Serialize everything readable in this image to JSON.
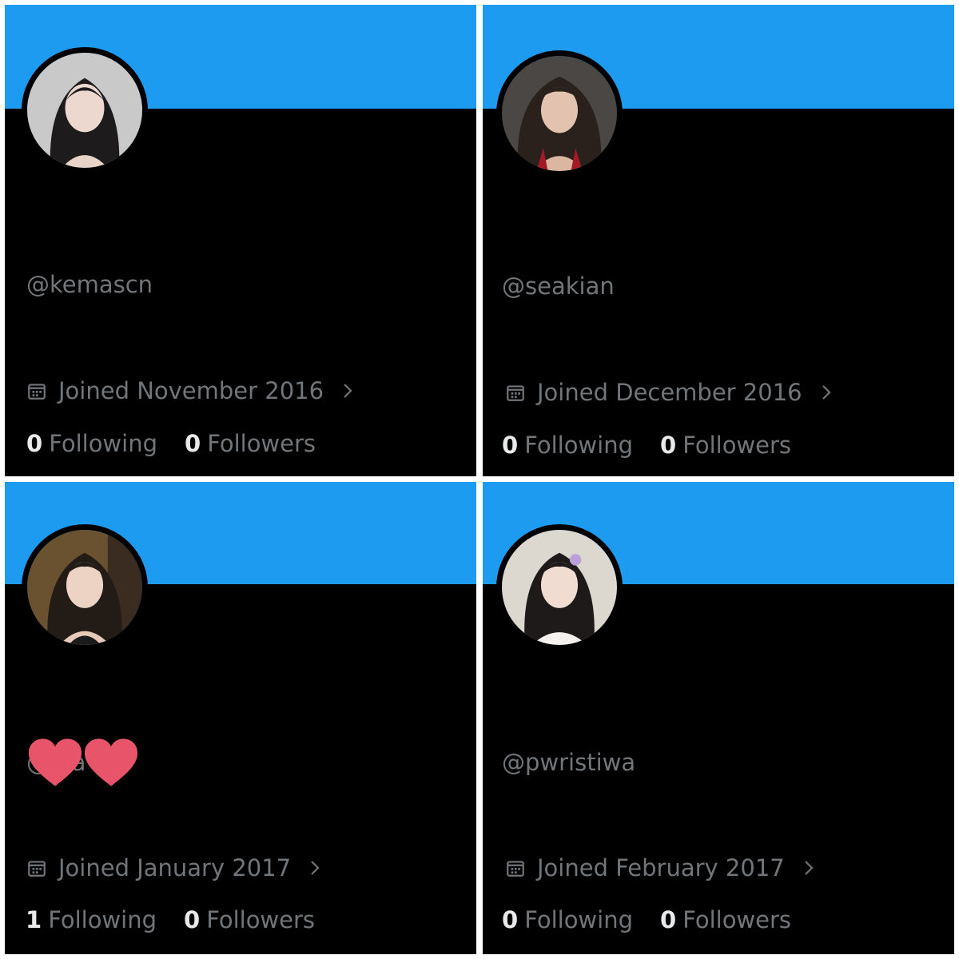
{
  "colors": {
    "banner": "#1d9bf0",
    "background": "#000000",
    "muted_text": "#71767b",
    "bold_text": "#e7e9ea",
    "divider": "#ffffff",
    "heart": "#e8546a"
  },
  "profiles": [
    {
      "handle": "@kemascn",
      "joined": "Joined November 2016",
      "following_count": "0",
      "following_label": "Following",
      "followers_count": "0",
      "followers_label": "Followers"
    },
    {
      "handle": "@seakian",
      "joined": "Joined December 2016",
      "following_count": "0",
      "following_label": "Following",
      "followers_count": "0",
      "followers_label": "Followers"
    },
    {
      "handle": "@u a",
      "joined": "Joined January 2017",
      "following_count": "1",
      "following_label": "Following",
      "followers_count": "0",
      "followers_label": "Followers"
    },
    {
      "handle": "@pwristiwa",
      "joined": "Joined February 2017",
      "following_count": "0",
      "following_label": "Following",
      "followers_count": "0",
      "followers_label": "Followers"
    }
  ],
  "icons": {
    "calendar": "calendar-icon",
    "chevron": "chevron-right-icon",
    "heart": "heart-sticker"
  }
}
